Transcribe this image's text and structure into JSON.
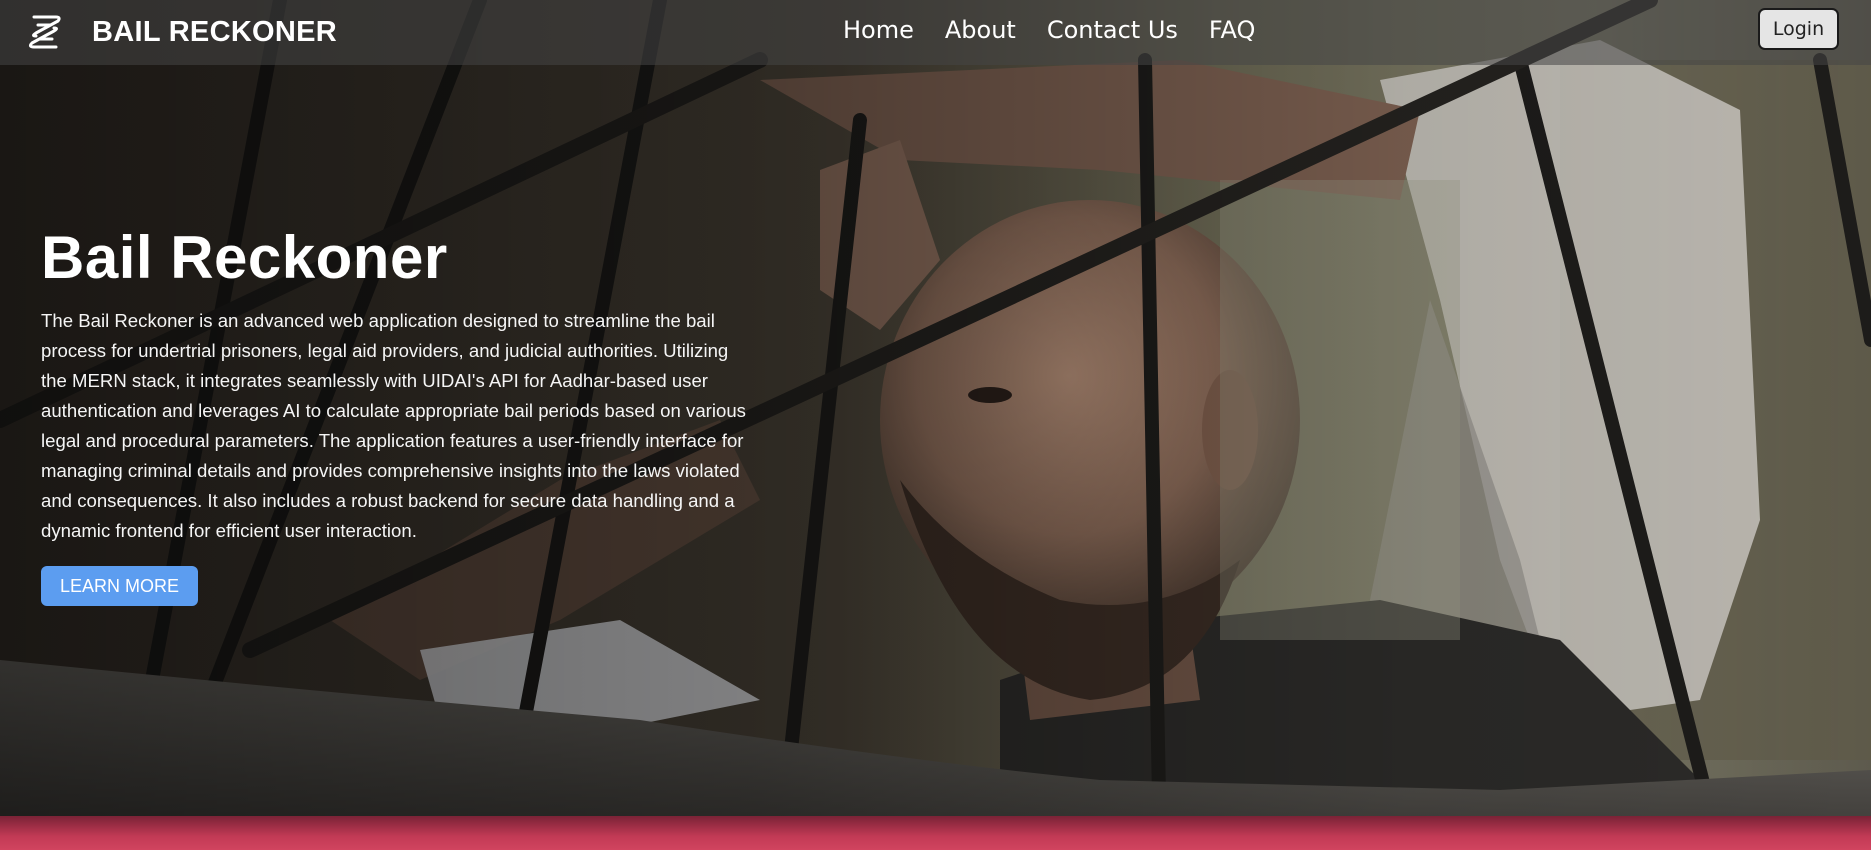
{
  "navbar": {
    "brand_name": "BAIL RECKONER",
    "logo_icon": "logo-icon",
    "links": [
      {
        "label": "Home"
      },
      {
        "label": "About"
      },
      {
        "label": "Contact Us"
      },
      {
        "label": "FAQ"
      }
    ],
    "login_label": "Login"
  },
  "hero": {
    "title": "Bail Reckoner",
    "description": "The Bail Reckoner is an advanced web application designed to streamline the bail process for undertrial prisoners, legal aid providers, and judicial authorities. Utilizing the MERN stack, it integrates seamlessly with UIDAI's API for Aadhar-based user authentication and leverages AI to calculate appropriate bail periods based on various legal and procedural parameters. The application features a user-friendly interface for managing criminal details and provides comprehensive insights into the laws violated and consequences. It also includes a robust backend for secure data handling and a dynamic frontend for efficient user interaction.",
    "cta_label": "LEARN MORE"
  },
  "colors": {
    "cta": "#5c9df0",
    "login_bg": "#e5e5e5",
    "bottom_band": "#c23a55"
  }
}
